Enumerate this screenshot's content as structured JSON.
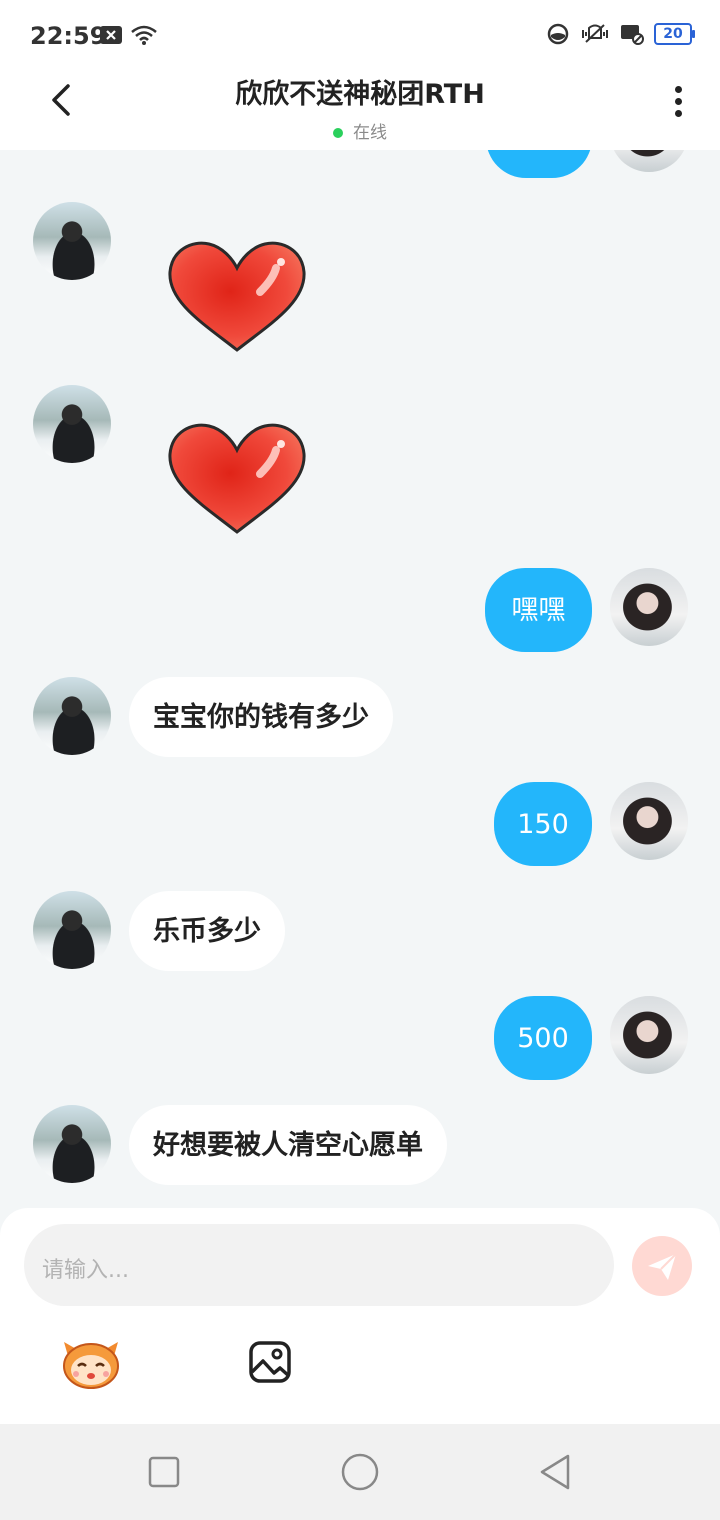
{
  "status_bar": {
    "time": "22:59",
    "battery": "20",
    "icons": [
      "close-box-icon",
      "wifi-icon",
      "data-saver-icon",
      "vibrate-icon",
      "dnd-icon",
      "battery-icon"
    ]
  },
  "header": {
    "title": "欣欣不送神秘团RTH",
    "status_text": "在线",
    "status_color": "#2ad05c"
  },
  "messages": [
    {
      "side": "right",
      "type": "partial"
    },
    {
      "side": "left",
      "type": "sticker",
      "sticker": "heart"
    },
    {
      "side": "left",
      "type": "sticker",
      "sticker": "heart"
    },
    {
      "side": "right",
      "type": "text",
      "text": "嘿嘿"
    },
    {
      "side": "left",
      "type": "text",
      "text": "宝宝你的钱有多少"
    },
    {
      "side": "right",
      "type": "text",
      "text": "150"
    },
    {
      "side": "left",
      "type": "text",
      "text": "乐币多少"
    },
    {
      "side": "right",
      "type": "text",
      "text": "500"
    },
    {
      "side": "left",
      "type": "text",
      "text": "好想要被人清空心愿单"
    }
  ],
  "composer": {
    "placeholder": "请输入...",
    "send_color": "#ffd9d3",
    "tools": [
      "emoji-icon",
      "image-icon"
    ]
  },
  "colors": {
    "outgoing_bubble": "#23b6fb",
    "incoming_bubble": "#ffffff",
    "background": "#f3f6f7"
  }
}
